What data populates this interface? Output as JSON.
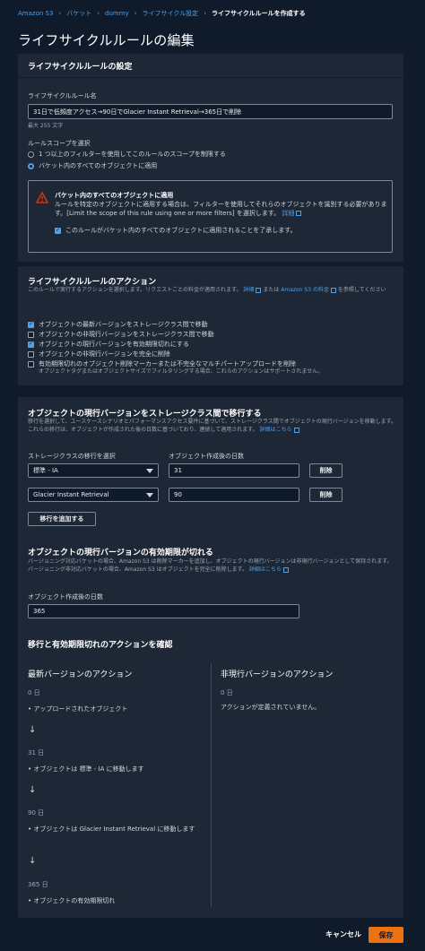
{
  "breadcrumb": {
    "items": [
      "Amazon S3",
      "バケット",
      "dummy",
      "ライフサイクル設定"
    ],
    "current": "ライフサイクルルールを作成する"
  },
  "page_title": "ライフサイクルルールの編集",
  "config": {
    "header": "ライフサイクルルールの設定",
    "name_label": "ライフサイクルルール名",
    "name_value": "31日で低頻度アクセス→90日でGlacier Instant Retrieval→365日で削除",
    "name_hint": "最大 255 文字",
    "scope_label": "ルールスコープを選択",
    "scope_option_filter": "1 つ以上のフィルターを使用してこのルールのスコープを制限する",
    "scope_option_all": "バケット内のすべてのオブジェクトに適用",
    "alert_title": "バケット内のすべてのオブジェクトに適用",
    "alert_body": "ルールを特定のオブジェクトに適用する場合は、フィルターを使用してそれらのオブジェクトを識別する必要があります。[Limit the scope of this rule using one or more filters] を選択します。",
    "alert_link": "詳細",
    "ack_label": "このルールがバケット内のすべてのオブジェクトに適用されることを了承します。"
  },
  "actions": {
    "title": "ライフサイクルルールのアクション",
    "desc_prefix": "このルールで実行するアクションを選択します。リクエストごとの料金が適用されます。",
    "desc_link1": "詳細",
    "desc_mid": "または",
    "desc_link2": "Amazon S3 の料金",
    "desc_suffix": "を参照してください",
    "options": [
      {
        "label": "オブジェクトの最新バージョンをストレージクラス間で移動",
        "checked": true
      },
      {
        "label": "オブジェクトの非現行バージョンをストレージクラス間で移動",
        "checked": false
      },
      {
        "label": "オブジェクトの現行バージョンを有効期限切れにする",
        "checked": true
      },
      {
        "label": "オブジェクトの非現行バージョンを完全に削除",
        "checked": false
      },
      {
        "label": "有効期限切れのオブジェクト削除マーカーまたは不完全なマルチパートアップロードを削除",
        "checked": false
      }
    ],
    "option_note": "オブジェクトタグまたはオブジェクトサイズでフィルタリングする場合、これらのアクションはサポートされません。"
  },
  "transition": {
    "title": "オブジェクトの現行バージョンをストレージクラス間で移行する",
    "desc": "移行を選択して、ユースケースシナリオとパフォーマンスアクセス要件に基づいて、ストレージクラス間でオブジェクトの現行バージョンを移動します。これらの移行は、オブジェクトが作成された後の日数に基づいており、連続して適用されます。",
    "desc_link": "詳細はこちら",
    "col_class": "ストレージクラスの移行を選択",
    "col_days": "オブジェクト作成後の日数",
    "rows": [
      {
        "storage_class": "標準 - IA",
        "days": "31",
        "delete_label": "削除"
      },
      {
        "storage_class": "Glacier Instant Retrieval",
        "days": "90",
        "delete_label": "削除"
      }
    ],
    "add_button": "移行を追加する"
  },
  "expiration": {
    "title": "オブジェクトの現行バージョンの有効期限が切れる",
    "desc": "バージョニング対応バケットの場合、Amazon S3 は削除マーカーを追加し、オブジェクトの現行バージョンは非現行バージョンとして保持されます。バージョニング非対応バケットの場合、Amazon S3 はオブジェクトを完全に削除します。",
    "desc_link": "詳細はこちら",
    "days_label": "オブジェクト作成後の日数",
    "days_value": "365"
  },
  "review": {
    "title": "移行と有効期限切れのアクションを確認",
    "current_col_title": "最新バージョンのアクション",
    "noncurrent_col_title": "非現行バージョンのアクション",
    "current_steps": [
      {
        "day": "0 日",
        "action": "アップロードされたオブジェクト"
      },
      {
        "day": "31 日",
        "action": "オブジェクトは 標準 - IA に移動します"
      },
      {
        "day": "90 日",
        "action": "オブジェクトは Glacier Instant Retrieval に移動します"
      },
      {
        "day": "365 日",
        "action": "オブジェクトの有効期限切れ"
      }
    ],
    "noncurrent_day": "0 日",
    "noncurrent_text": "アクションが定義されていません。"
  },
  "footer": {
    "cancel": "キャンセル",
    "save": "保存"
  },
  "colors": {
    "background": "#0f1b2a",
    "panel": "#1e2735",
    "link": "#539fe5",
    "primary_button": "#ec7211",
    "warning": "#d13212"
  }
}
